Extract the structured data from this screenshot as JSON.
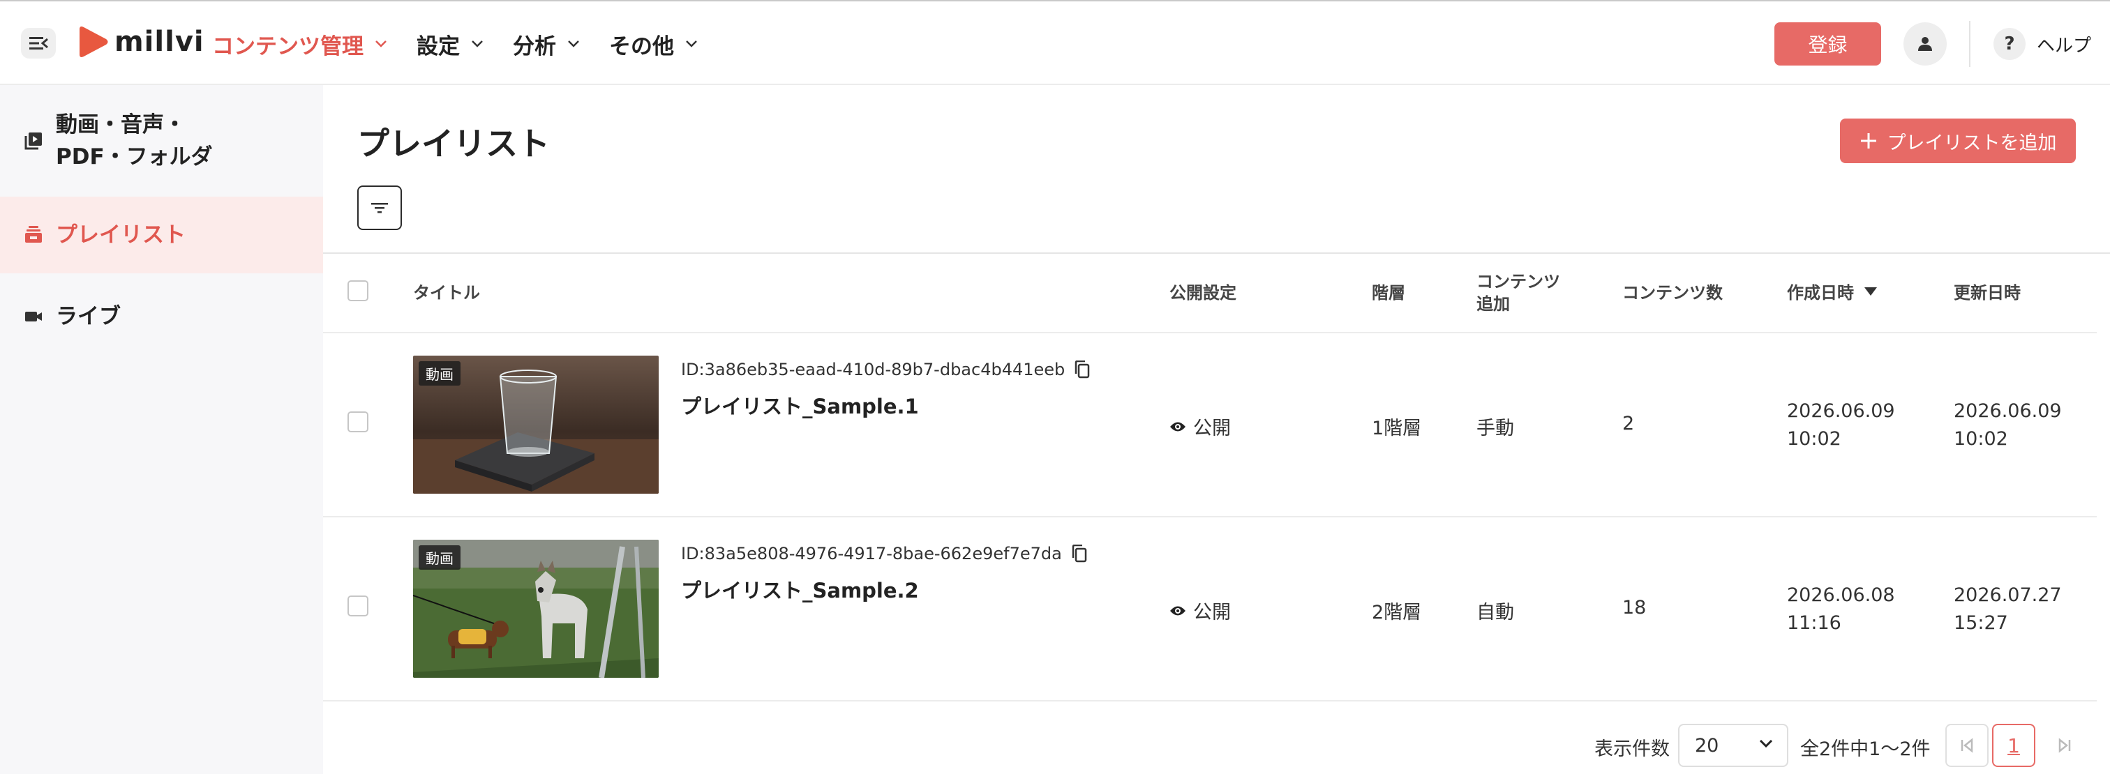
{
  "header": {
    "logo_text": "millvi",
    "nav": [
      {
        "label": "コンテンツ管理",
        "active": true
      },
      {
        "label": "設定",
        "active": false
      },
      {
        "label": "分析",
        "active": false
      },
      {
        "label": "その他",
        "active": false
      }
    ],
    "register_label": "登録",
    "help_label": "ヘルプ",
    "help_icon_text": "?"
  },
  "sidebar": {
    "items": [
      {
        "label_line1": "動画・音声・",
        "label_line2": "PDF・フォルダ",
        "icon": "video-library-icon"
      },
      {
        "label": "プレイリスト",
        "icon": "playlist-icon",
        "active": true
      },
      {
        "label": "ライブ",
        "icon": "live-camera-icon"
      }
    ]
  },
  "main": {
    "title": "プレイリスト",
    "add_button_label": "プレイリストを追加",
    "columns": {
      "title": "タイトル",
      "visibility": "公開設定",
      "level": "階層",
      "content_add_line1": "コンテンツ",
      "content_add_line2": "追加",
      "content_count": "コンテンツ数",
      "created": "作成日時",
      "updated": "更新日時"
    },
    "rows": [
      {
        "tag": "動画",
        "id": "ID:3a86eb35-eaad-410d-89b7-dbac4b441eeb",
        "title": "プレイリスト_Sample.1",
        "visibility": "公開",
        "level": "1階層",
        "content_add": "手動",
        "content_count": "2",
        "created_date": "2026.06.09",
        "created_time": "10:02",
        "updated_date": "2026.06.09",
        "updated_time": "10:02"
      },
      {
        "tag": "動画",
        "id": "ID:83a5e808-4976-4917-8bae-662e9ef7e7da",
        "title": "プレイリスト_Sample.2",
        "visibility": "公開",
        "level": "2階層",
        "content_add": "自動",
        "content_count": "18",
        "created_date": "2026.06.08",
        "created_time": "11:16",
        "updated_date": "2026.07.27",
        "updated_time": "15:27"
      }
    ]
  },
  "pagination": {
    "per_page_label": "表示件数",
    "per_page_value": "20",
    "info": "全2件中1〜2件",
    "current_page": "1"
  },
  "colors": {
    "accent": "#e76a66",
    "accent_text": "#e0574f",
    "sidebar_bg": "#f7f7f9",
    "active_bg": "#fcebea"
  }
}
